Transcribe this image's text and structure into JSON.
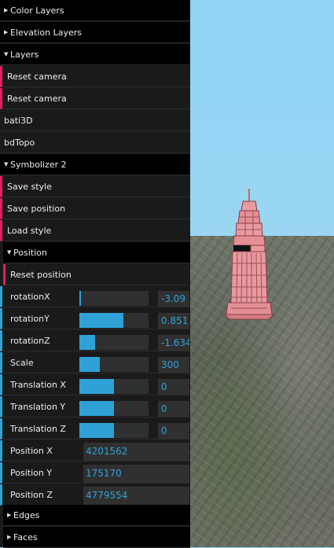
{
  "panel": {
    "color_layers": "Color Layers",
    "elevation_layers": "Elevation Layers",
    "layers": "Layers",
    "reset_camera_1": "Reset camera",
    "reset_camera_2": "Reset camera",
    "bati3d": "bati3D",
    "bdtopo": "bdTopo",
    "symbolizer": "Symbolizer 2",
    "save_style": "Save style",
    "save_position": "Save position",
    "load_style": "Load style",
    "position_folder": "Position",
    "reset_position": "Reset position",
    "edges": "Edges",
    "faces": "Faces"
  },
  "controls": {
    "rotationX": {
      "label": "rotationX",
      "value": "-3.09",
      "fill_fraction": 0.0
    },
    "rotationY": {
      "label": "rotationY",
      "value": "0.851",
      "fill_fraction": 0.64
    },
    "rotationZ": {
      "label": "rotationZ",
      "value": "-1.634",
      "fill_fraction": 0.23
    },
    "scale": {
      "label": "Scale",
      "value": "300",
      "fill_fraction": 0.3
    },
    "translation_x": {
      "label": "Translation X",
      "value": "0",
      "fill_fraction": 0.5
    },
    "translation_y": {
      "label": "Translation Y",
      "value": "0",
      "fill_fraction": 0.5
    },
    "translation_z": {
      "label": "Translation Z",
      "value": "0",
      "fill_fraction": 0.5
    },
    "position_x": {
      "label": "Position X",
      "value": "4201562"
    },
    "position_y": {
      "label": "Position Y",
      "value": "175170"
    },
    "position_z": {
      "label": "Position Z",
      "value": "4779554"
    }
  },
  "colors": {
    "accent_function": "#e61d5f",
    "accent_number": "#2fa1d6",
    "panel_bg": "#1a1a1a",
    "sky": "#90d3f4",
    "tower": "#e89aa0"
  },
  "icons": {
    "collapsed": "triangle-right-icon",
    "expanded": "triangle-down-icon"
  }
}
